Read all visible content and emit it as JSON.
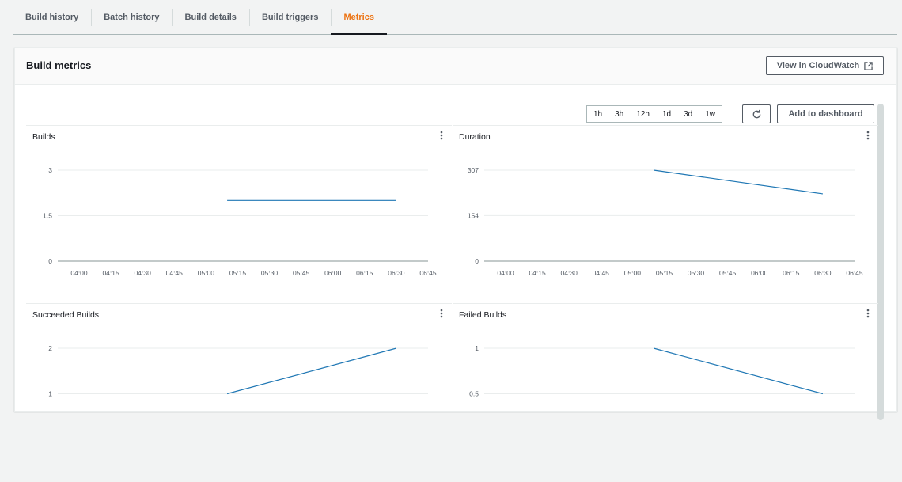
{
  "tabs": [
    {
      "label": "Build history"
    },
    {
      "label": "Batch history"
    },
    {
      "label": "Build details"
    },
    {
      "label": "Build triggers"
    },
    {
      "label": "Metrics",
      "active": true
    }
  ],
  "panel": {
    "title": "Build metrics",
    "cloudwatch_label": "View in CloudWatch",
    "cloudwatch_icon": "external-link-icon",
    "ranges": [
      "1h",
      "3h",
      "12h",
      "1d",
      "3d",
      "1w"
    ],
    "refresh_icon": "refresh-icon",
    "add_label": "Add to dashboard"
  },
  "colors": {
    "line": "#1f77b4",
    "accent": "#ec7211"
  },
  "chart_data": [
    {
      "type": "line",
      "title": "Builds",
      "x": [
        "04:00",
        "04:15",
        "04:30",
        "04:45",
        "05:00",
        "05:15",
        "05:30",
        "05:45",
        "06:00",
        "06:15",
        "06:30",
        "06:45"
      ],
      "yticks": [
        "0",
        "1.5",
        "3"
      ],
      "ylim": [
        0,
        3
      ],
      "series": [
        {
          "x": [
            "05:10",
            "06:30"
          ],
          "values": [
            2,
            2
          ]
        }
      ]
    },
    {
      "type": "line",
      "title": "Duration",
      "x": [
        "04:00",
        "04:15",
        "04:30",
        "04:45",
        "05:00",
        "05:15",
        "05:30",
        "05:45",
        "06:00",
        "06:15",
        "06:30",
        "06:45"
      ],
      "yticks": [
        "0",
        "154",
        "307"
      ],
      "ylim": [
        0,
        307
      ],
      "series": [
        {
          "x": [
            "05:10",
            "06:30"
          ],
          "values": [
            307,
            227
          ]
        }
      ]
    },
    {
      "type": "line",
      "title": "Succeeded Builds",
      "x": [],
      "yticks": [
        "1",
        "2"
      ],
      "ylim": [
        0,
        2
      ],
      "series": [
        {
          "x": [
            "05:10",
            "06:30"
          ],
          "values": [
            1,
            2
          ]
        }
      ]
    },
    {
      "type": "line",
      "title": "Failed Builds",
      "x": [],
      "yticks": [
        "0.5",
        "1"
      ],
      "ylim": [
        0,
        1
      ],
      "series": [
        {
          "x": [
            "05:10",
            "06:30"
          ],
          "values": [
            1,
            0.5
          ]
        }
      ]
    }
  ]
}
